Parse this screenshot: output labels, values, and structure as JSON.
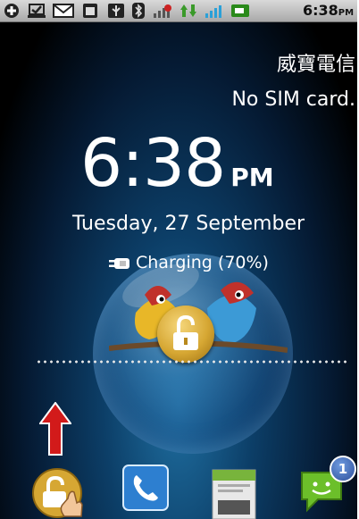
{
  "status_bar": {
    "icons": [
      "add-icon",
      "download-done-icon",
      "gmail-icon",
      "android-debug-icon",
      "usb-icon",
      "bluetooth-icon",
      "no-sim-signal-icon",
      "data-transfer-icon",
      "signal-icon",
      "battery-charging-icon"
    ],
    "time": "6:38",
    "ampm": "PM"
  },
  "lockscreen": {
    "carrier": "威寶電信",
    "sim_status": "No SIM card.",
    "clock": {
      "time": "6:38",
      "ampm": "PM"
    },
    "date": "Tuesday, 27 September",
    "charging": "Charging (70%)"
  },
  "dock": {
    "items": [
      "unlock-icon",
      "phone-icon",
      "android-market-icon",
      "messaging-icon"
    ],
    "messaging_badge": "1"
  },
  "colors": {
    "accent_gold": "#d6a733",
    "arrow_red": "#d21a1a",
    "phone_blue": "#2d7fd0",
    "message_green": "#6cbf2a"
  }
}
